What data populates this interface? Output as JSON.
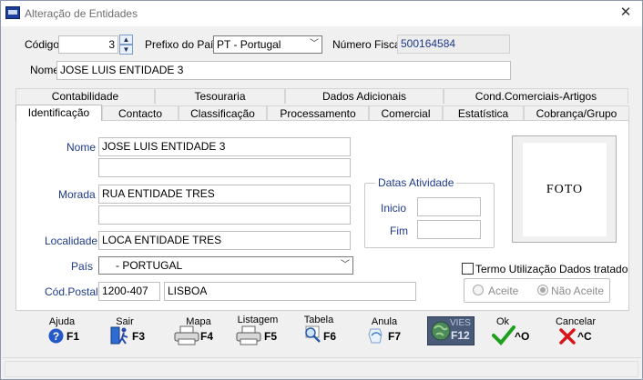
{
  "window": {
    "title": "Alteração de Entidades",
    "close_glyph": "✕"
  },
  "header": {
    "codigo_label": "Código",
    "codigo_value": "3",
    "prefixo_label": "Prefixo do País",
    "prefixo_value": "PT - Portugal",
    "nif_label": "Número Fiscal",
    "nif_value": "500164584",
    "nome_label": "Nome",
    "nome_value": "JOSE LUIS ENTIDADE 3"
  },
  "tabs": {
    "top": [
      "Contabilidade",
      "Tesouraria",
      "Dados Adicionais",
      "Cond.Comerciais-Artigos"
    ],
    "bottom": [
      "Identificação",
      "Contacto",
      "Classificação",
      "Processamento",
      "Comercial",
      "Estatística",
      "Cobrança/Grupo"
    ],
    "active": "Identificação"
  },
  "ident": {
    "nome_label": "Nome",
    "nome1": "JOSE LUIS ENTIDADE 3",
    "nome2": "",
    "morada_label": "Morada",
    "morada1": "RUA ENTIDADE TRES",
    "morada2": "",
    "localidade_label": "Localidade",
    "localidade_value": "LOCA ENTIDADE TRES",
    "pais_label": "País",
    "pais_value": "- PORTUGAL",
    "codpostal_label": "Cód.Postal",
    "codpostal_value": "1200-407",
    "cidade_value": "LISBOA"
  },
  "datas": {
    "title": "Datas Atividade",
    "inicio_label": "Inicio",
    "inicio_value": "",
    "fim_label": "Fim",
    "fim_value": ""
  },
  "foto": {
    "label": "FOTO"
  },
  "termo": {
    "label": "Termo Utilização Dados tratado",
    "checked": false,
    "aceite_label": "Aceite",
    "nao_aceite_label": "Não Aceite",
    "selected": "Não Aceite"
  },
  "toolbar": [
    {
      "name": "ajuda",
      "label": "Ajuda",
      "key": "F1",
      "icon": "help-icon"
    },
    {
      "name": "sair",
      "label": "Sair",
      "key": "F3",
      "icon": "exit-icon"
    },
    {
      "name": "mapa",
      "label": "Mapa",
      "key": "F4",
      "icon": "printer-icon"
    },
    {
      "name": "listagem",
      "label": "Listagem",
      "key": "F5",
      "icon": "printer-icon"
    },
    {
      "name": "tabela",
      "label": "Tabela",
      "key": "F6",
      "icon": "magnifier-icon"
    },
    {
      "name": "anula",
      "label": "Anula",
      "key": "F7",
      "icon": "undo-icon"
    },
    {
      "name": "vies",
      "label": "VIES",
      "key": "F12",
      "icon": "globe-icon"
    },
    {
      "name": "ok",
      "label": "Ok",
      "key": "^O",
      "icon": "check-icon"
    },
    {
      "name": "cancelar",
      "label": "Cancelar",
      "key": "^C",
      "icon": "x-icon"
    }
  ],
  "colors": {
    "accent_blue": "#1e3a8a",
    "check_green": "#1ea01e",
    "cancel_red": "#d8161a",
    "help_blue": "#2458c9"
  }
}
